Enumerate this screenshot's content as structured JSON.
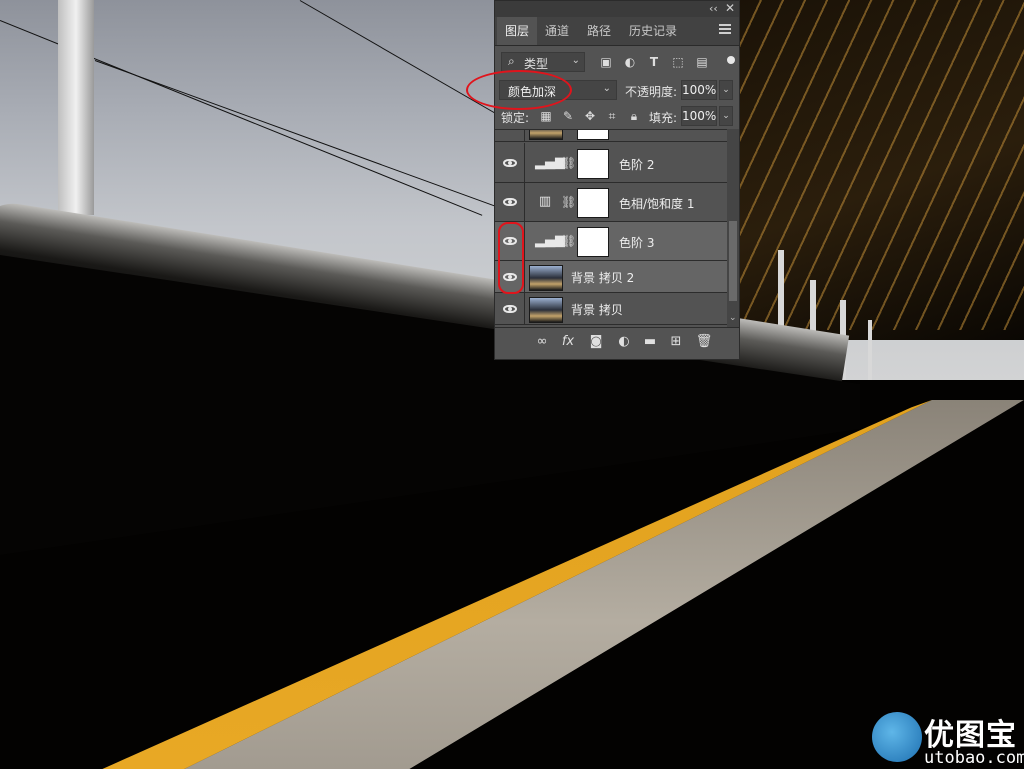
{
  "panel": {
    "tabs": [
      {
        "label": "图层",
        "active": true
      },
      {
        "label": "通道",
        "active": false
      },
      {
        "label": "路径",
        "active": false
      },
      {
        "label": "历史记录",
        "active": false
      }
    ],
    "collapse_glyph": "‹‹",
    "close_glyph": "✕",
    "filter": {
      "label": "类型"
    },
    "blend_mode": "颜色加深",
    "opacity_label": "不透明度:",
    "opacity_value": "100%",
    "lock_label": "锁定:",
    "fill_label": "填充:",
    "fill_value": "100%",
    "layers": [
      {
        "name": "色阶 2",
        "type": "levels",
        "visible": true,
        "selected": false
      },
      {
        "name": "色相/饱和度 1",
        "type": "hue-saturation",
        "visible": true,
        "selected": false
      },
      {
        "name": "色阶 3",
        "type": "levels",
        "visible": true,
        "selected": true
      },
      {
        "name": "背景 拷贝 2",
        "type": "photo",
        "visible": true,
        "selected": true
      },
      {
        "name": "背景 拷贝",
        "type": "photo",
        "visible": true,
        "selected": false
      }
    ],
    "bottom_icons": [
      "link-icon",
      "fx-icon",
      "mask-icon",
      "adjustment-icon",
      "folder-icon",
      "new-layer-icon",
      "trash-icon"
    ]
  },
  "watermark": {
    "title": "优图宝",
    "subtitle": "utobao.com"
  },
  "colors": {
    "panel_bg": "#535353",
    "annotation_red": "#e0141c",
    "platform_yellow": "#e8a825"
  }
}
